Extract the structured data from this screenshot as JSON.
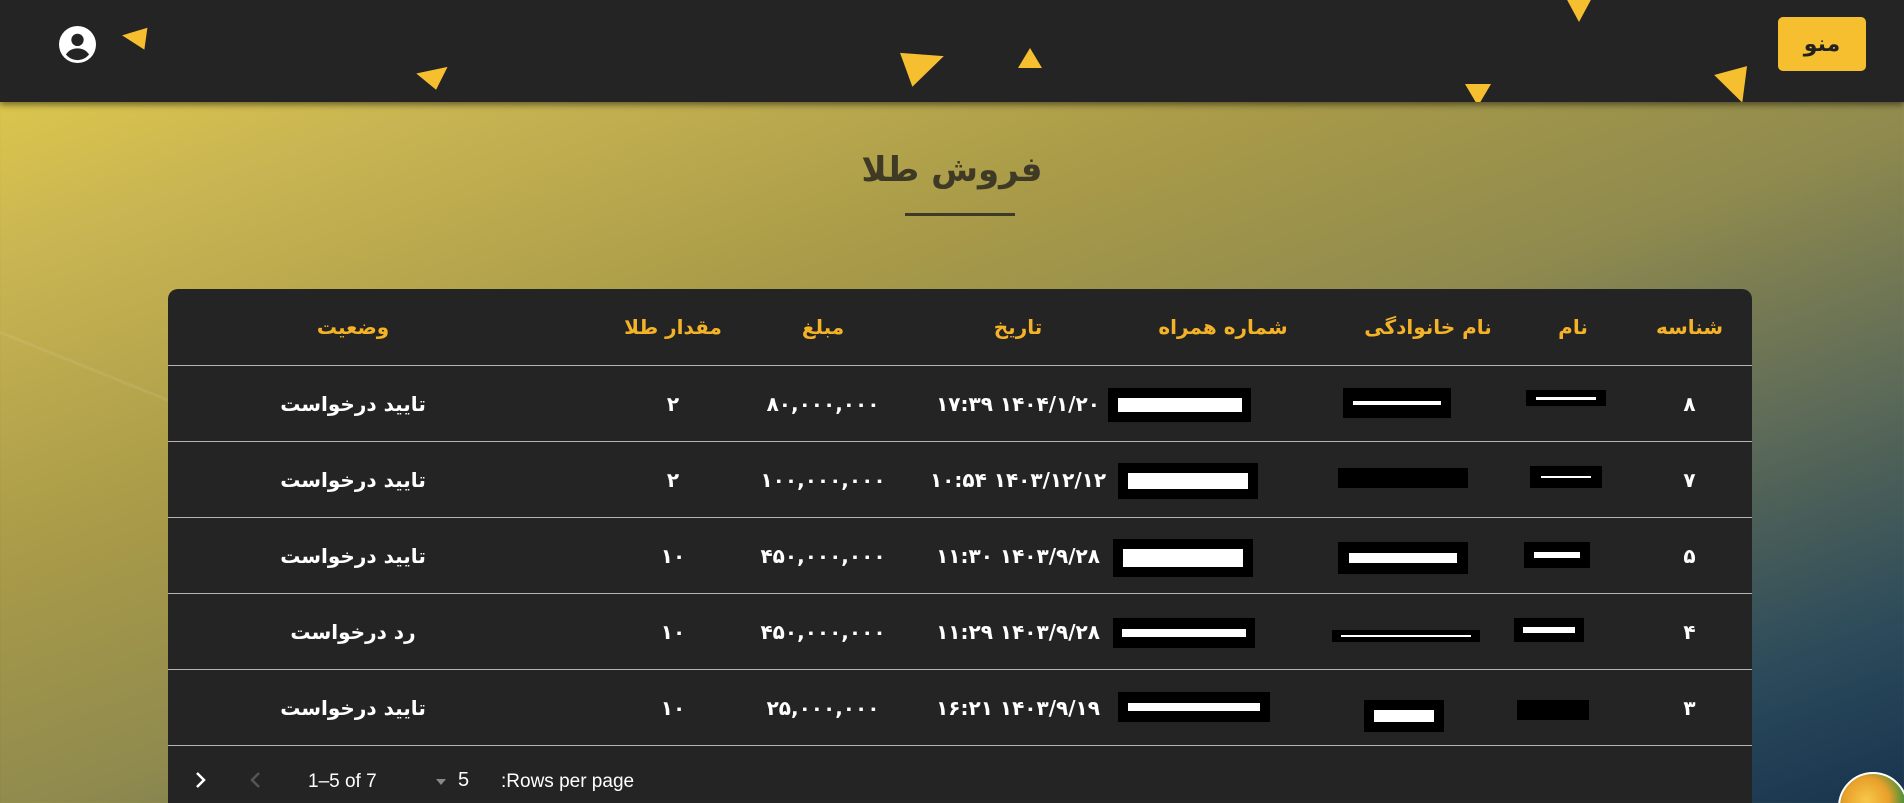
{
  "header": {
    "menu_label": "منو"
  },
  "page": {
    "title": "فروش طلا"
  },
  "table": {
    "headers": {
      "id": "شناسه",
      "name": "نام",
      "family": "نام خانوادگی",
      "phone": "شماره همراه",
      "date": "تاریخ",
      "amount": "مبلغ",
      "gold": "مقدار طلا",
      "status": "وضعیت"
    },
    "rows": [
      {
        "id": "۸",
        "date": "۱۴۰۴/۱/۲۰ ۱۷:۳۹",
        "amount": "۸۰,۰۰۰,۰۰۰",
        "gold": "۲",
        "status": "تایید درخواست"
      },
      {
        "id": "۷",
        "date": "۱۴۰۳/۱۲/۱۲ ۱۰:۵۴",
        "amount": "۱۰۰,۰۰۰,۰۰۰",
        "gold": "۲",
        "status": "تایید درخواست"
      },
      {
        "id": "۵",
        "date": "۱۴۰۳/۹/۲۸ ۱۱:۳۰",
        "amount": "۴۵۰,۰۰۰,۰۰۰",
        "gold": "۱۰",
        "status": "تایید درخواست"
      },
      {
        "id": "۴",
        "date": "۱۴۰۳/۹/۲۸ ۱۱:۲۹",
        "amount": "۴۵۰,۰۰۰,۰۰۰",
        "gold": "۱۰",
        "status": "رد درخواست"
      },
      {
        "id": "۳",
        "date": "۱۴۰۳/۹/۱۹ ۱۶:۲۱",
        "amount": "۲۵,۰۰۰,۰۰۰",
        "gold": "۱۰",
        "status": "تایید درخواست"
      }
    ]
  },
  "pagination": {
    "rows_per_page_label": ":Rows per page",
    "rows_per_page_value": "5",
    "range_text": "1–5 of 7"
  },
  "colors": {
    "topbar": "#252424",
    "accent": "#f6bf2f",
    "header_text": "#f4b327",
    "table_bg": "#252424"
  }
}
